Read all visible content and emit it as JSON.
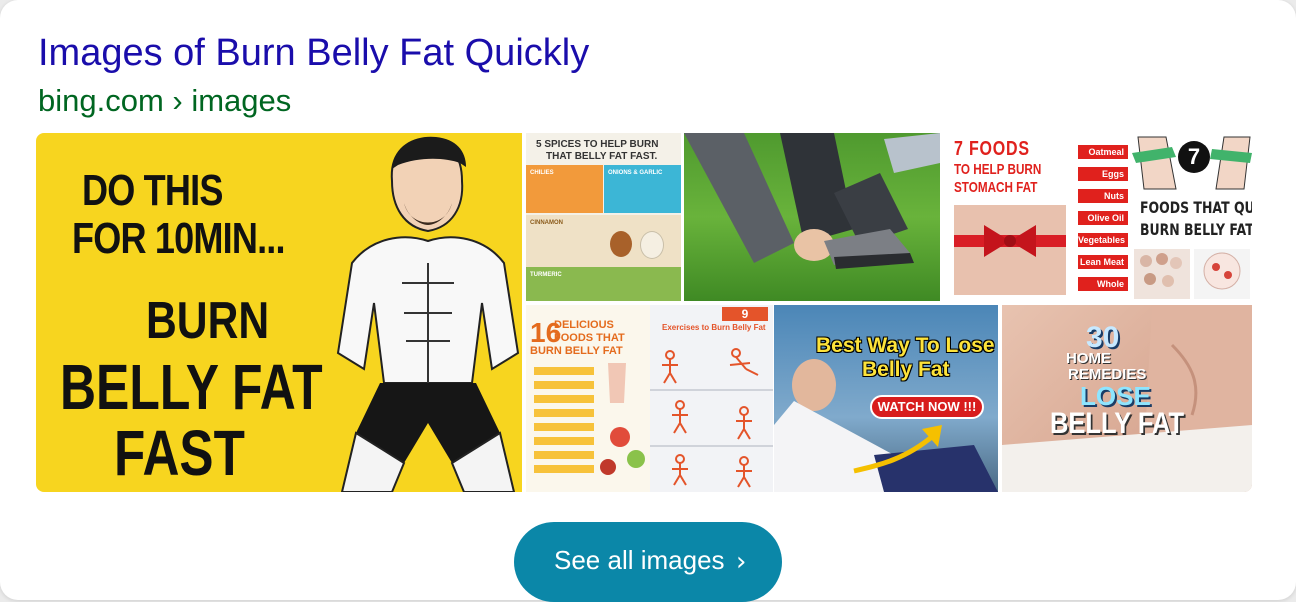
{
  "result": {
    "title": "Images of Burn Belly Fat Quickly",
    "source": "bing.com › images"
  },
  "images": [
    {
      "id": "do-this",
      "lines": [
        "DO THIS",
        "FOR 10MIN...",
        "BURN",
        "BELLY FAT",
        "FAST"
      ]
    },
    {
      "id": "spices",
      "heading": [
        "5 SPICES TO HELP BURN",
        "THAT BELLY FAT FAST."
      ],
      "labels": [
        "CHILIES",
        "ONIONS & GARLIC",
        "CINNAMON",
        "TURMERIC"
      ]
    },
    {
      "id": "grass"
    },
    {
      "id": "seven-foods",
      "heading": [
        "7 FOODS",
        "TO HELP BURN",
        "STOMACH FAT"
      ],
      "items": [
        "Oatmeal",
        "Eggs",
        "Nuts",
        "Olive Oil",
        "Vegetables",
        "Lean Meat",
        "Whole Grains"
      ]
    },
    {
      "id": "foods-that-quickly",
      "badge": "7",
      "lines": [
        "FOODS THAT QUICKLY",
        "BURN BELLY FAT"
      ]
    },
    {
      "id": "sixteen-foods",
      "number": "16",
      "lines": [
        "DELICIOUS",
        "FOODS THAT",
        "BURN BELLY FAT"
      ]
    },
    {
      "id": "exercises",
      "badge": "9",
      "heading": "Exercises to Burn Belly Fat"
    },
    {
      "id": "best-way",
      "lines": [
        "Best Way To Lose",
        "Belly Fat"
      ],
      "button": "WATCH NOW !!!"
    },
    {
      "id": "home-remedies",
      "lines": [
        "30",
        "HOME",
        "REMEDIES",
        "LOSE",
        "BELLY FAT"
      ]
    }
  ],
  "see_all": {
    "label": "See all images",
    "chevron": "›"
  },
  "colors": {
    "title": "#1a0dab",
    "source": "#006621",
    "button": "#0b87a8"
  }
}
